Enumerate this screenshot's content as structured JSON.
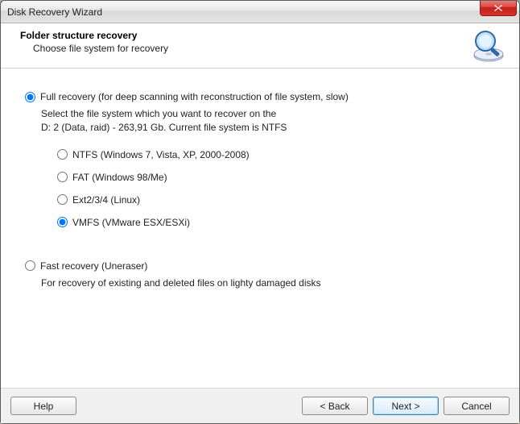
{
  "window": {
    "title": "Disk Recovery Wizard"
  },
  "header": {
    "title": "Folder structure recovery",
    "subtitle": "Choose file system for recovery"
  },
  "mode": {
    "full_label": "Full recovery (for deep scanning with reconstruction of file system, slow)",
    "full_info_line1": "Select the file system which you want to recover on the",
    "full_info_line2": "D: 2 (Data, raid) - 263,91 Gb. Current file system is NTFS",
    "fast_label": "Fast recovery (Uneraser)",
    "fast_info": "For recovery of existing and deleted files on lighty damaged disks"
  },
  "fs": {
    "ntfs": "NTFS (Windows 7, Vista, XP, 2000-2008)",
    "fat": "FAT (Windows 98/Me)",
    "ext": "Ext2/3/4 (Linux)",
    "vmfs": "VMFS (VMware ESX/ESXi)"
  },
  "buttons": {
    "help": "Help",
    "back": "< Back",
    "next": "Next >",
    "cancel": "Cancel"
  }
}
